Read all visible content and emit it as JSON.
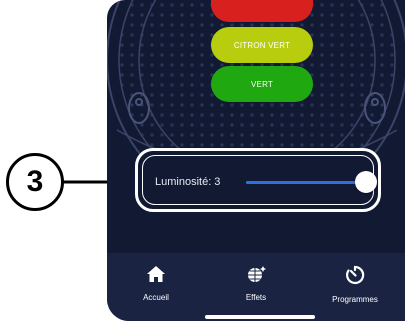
{
  "colors": {
    "screen_bg": "#121a33",
    "tabbar_bg": "#1a2442",
    "red": "#d8201e",
    "citron": "#b9cd0f",
    "vert": "#1fa80f",
    "slider_blue": "#2f6fe0"
  },
  "color_buttons": [
    {
      "label": "",
      "color": "#d8201e"
    },
    {
      "label": "CITRON VERT",
      "color": "#b9cd0f"
    },
    {
      "label": "VERT",
      "color": "#1fa80f"
    }
  ],
  "callout": {
    "number": "3"
  },
  "brightness": {
    "label": "Luminosité: 3",
    "level_fraction": 1.0
  },
  "tabbar": {
    "items": [
      {
        "label": "Accueil",
        "icon": "home-icon"
      },
      {
        "label": "Effets",
        "icon": "disco-ball-icon"
      },
      {
        "label": "Programmes",
        "icon": "timer-icon"
      }
    ]
  }
}
